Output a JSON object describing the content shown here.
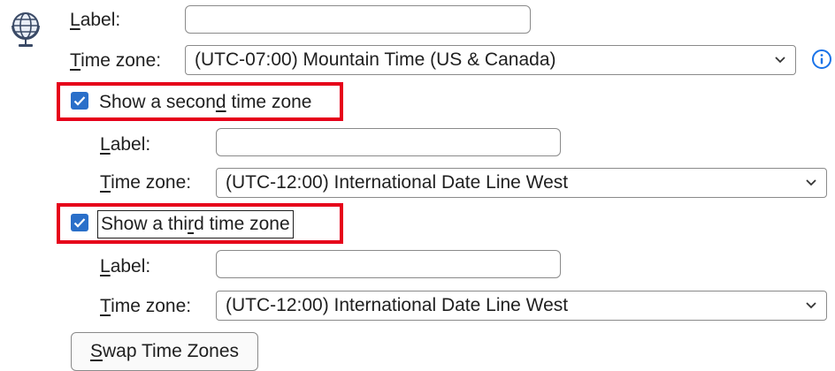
{
  "primary": {
    "label_caption": {
      "pre": "",
      "key": "L",
      "post": "abel:"
    },
    "label_value": "",
    "tz_caption": {
      "pre": "",
      "key": "T",
      "post": "ime zone:"
    },
    "tz_value": "(UTC-07:00) Mountain Time (US & Canada)"
  },
  "second": {
    "checkbox": {
      "pre": "Show a secon",
      "key": "d",
      "post": " time zone",
      "checked": true
    },
    "label_caption": {
      "pre": "",
      "key": "L",
      "post": "abel:"
    },
    "label_value": "",
    "tz_caption": {
      "pre": "",
      "key": "T",
      "post": "ime zone:"
    },
    "tz_value": "(UTC-12:00) International Date Line West"
  },
  "third": {
    "checkbox": {
      "pre": "Show a thi",
      "key": "r",
      "post": "d time zone",
      "checked": true
    },
    "label_caption": {
      "pre": "",
      "key": "L",
      "post": "abel:"
    },
    "label_value": "",
    "tz_caption": {
      "pre": "",
      "key": "T",
      "post": "ime zone:"
    },
    "tz_value": "(UTC-12:00) International Date Line West"
  },
  "swap_button": {
    "pre": "",
    "key": "S",
    "post": "wap Time Zones"
  },
  "colors": {
    "accent": "#2a6fc9",
    "highlight": "#e6001a",
    "info": "#1a73e8"
  },
  "icons": {
    "globe": "globe-icon",
    "info": "info-icon",
    "chevron": "chevron-down-icon",
    "check": "checkmark-icon"
  }
}
